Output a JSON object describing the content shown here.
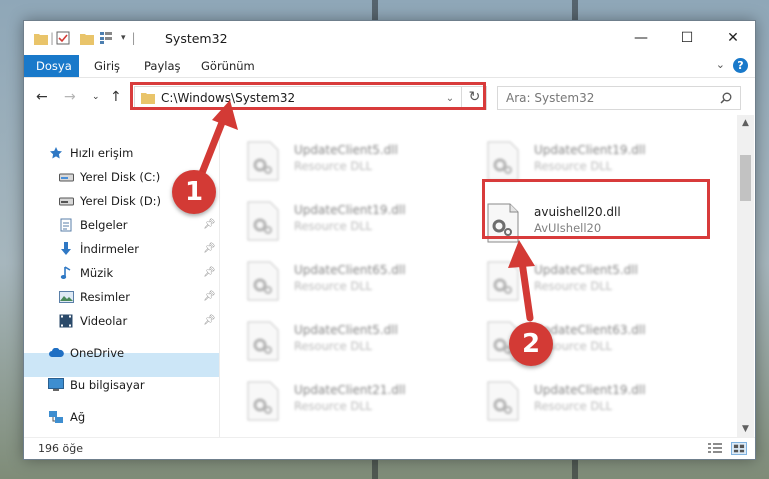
{
  "window": {
    "title": "System32"
  },
  "ribbon": {
    "tabs": [
      {
        "label": "Dosya",
        "active": true
      },
      {
        "label": "Giriş",
        "active": false
      },
      {
        "label": "Paylaş",
        "active": false
      },
      {
        "label": "Görünüm",
        "active": false
      }
    ]
  },
  "address": {
    "path": "C:\\Windows\\System32"
  },
  "search": {
    "placeholder": "Ara: System32"
  },
  "nav": {
    "quick_access": "Hızlı erişim",
    "items": [
      {
        "label": "Yerel Disk (C:)",
        "icon": "drive-icon",
        "pinned": false
      },
      {
        "label": "Yerel Disk (D:)",
        "icon": "drive-icon",
        "pinned": false
      },
      {
        "label": "Belgeler",
        "icon": "documents-icon",
        "pinned": true
      },
      {
        "label": "İndirmeler",
        "icon": "download-icon",
        "pinned": true
      },
      {
        "label": "Müzik",
        "icon": "music-icon",
        "pinned": true
      },
      {
        "label": "Resimler",
        "icon": "pictures-icon",
        "pinned": true
      },
      {
        "label": "Videolar",
        "icon": "videos-icon",
        "pinned": true
      }
    ],
    "onedrive": "OneDrive",
    "this_pc": "Bu bilgisayar",
    "network": "Ağ"
  },
  "files": {
    "left": [
      {
        "name": "UpdateClient5.dll",
        "desc": "Resource DLL"
      },
      {
        "name": "UpdateClient19.dll",
        "desc": "Resource DLL"
      },
      {
        "name": "UpdateClient65.dll",
        "desc": "Resource DLL"
      },
      {
        "name": "UpdateClient5.dll",
        "desc": "Resource DLL"
      },
      {
        "name": "UpdateClient21.dll",
        "desc": "Resource DLL"
      }
    ],
    "right": [
      {
        "name": "UpdateClient19.dll",
        "desc": "Resource DLL"
      },
      {
        "name": "avuishell20.dll",
        "desc": "AvUIshell20"
      },
      {
        "name": "UpdateClient5.dll",
        "desc": "Resource DLL"
      },
      {
        "name": "UpdateClient63.dll",
        "desc": "Resource DLL"
      },
      {
        "name": "UpdateClient19.dll",
        "desc": "Resource DLL"
      }
    ]
  },
  "status": {
    "count": "196 öğe"
  },
  "callouts": {
    "one": "1",
    "two": "2"
  },
  "colors": {
    "accent": "#1979ca",
    "highlight": "#d83b3b",
    "selected": "#cce6f7"
  }
}
